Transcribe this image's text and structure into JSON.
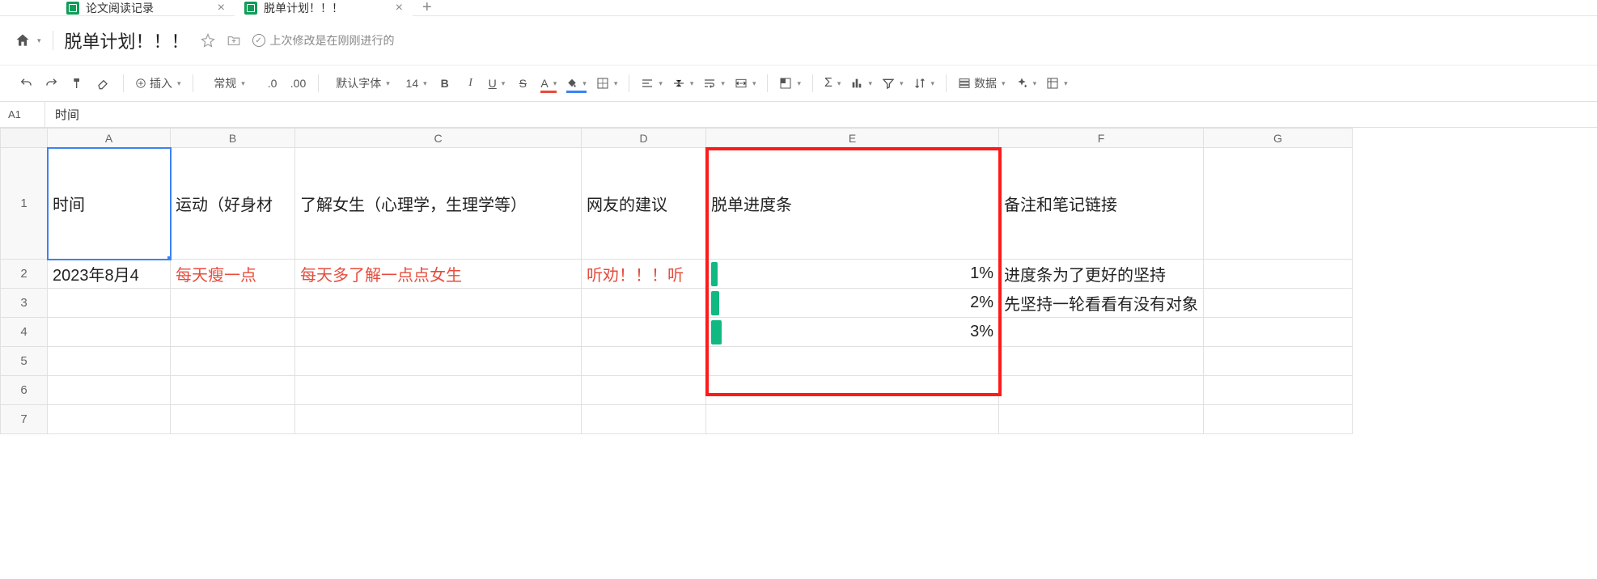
{
  "tabs": [
    {
      "label": "论文阅读记录",
      "active": false
    },
    {
      "label": "脱单计划！！！",
      "active": true
    }
  ],
  "doc": {
    "title": "脱单计划！！！",
    "save_status": "上次修改是在刚刚进行的"
  },
  "toolbar": {
    "insert": "插入",
    "format_number": "常规",
    "decimal": ".0",
    "decimal2": ".00",
    "font": "默认字体",
    "font_size": "14",
    "data_label": "数据"
  },
  "name_box": "A1",
  "formula_bar": "时间",
  "columns": [
    "A",
    "B",
    "C",
    "D",
    "E",
    "F",
    "G"
  ],
  "row_numbers": [
    "1",
    "2",
    "3",
    "4",
    "5",
    "6",
    "7"
  ],
  "headers": {
    "A": "时间",
    "B": "运动（好身材",
    "C": "了解女生（心理学，生理学等）",
    "D": "网友的建议",
    "E": "脱单进度条",
    "F": "备注和笔记链接"
  },
  "rows": [
    {
      "A": "2023年8月4",
      "B": "每天瘦一点",
      "C": "每天多了解一点点女生",
      "D": "听劝！！！听",
      "E_pct": "1%",
      "E_width": 8,
      "F": "进度条为了更好的坚持"
    },
    {
      "A": "",
      "B": "",
      "C": "",
      "D": "",
      "E_pct": "2%",
      "E_width": 10,
      "F": "先坚持一轮看看有没有对象"
    },
    {
      "A": "",
      "B": "",
      "C": "",
      "D": "",
      "E_pct": "3%",
      "E_width": 13,
      "F": ""
    }
  ],
  "colors": {
    "text_accent": "#e74c3c",
    "fill_accent": "#3b82f6",
    "progress": "#10b981"
  }
}
